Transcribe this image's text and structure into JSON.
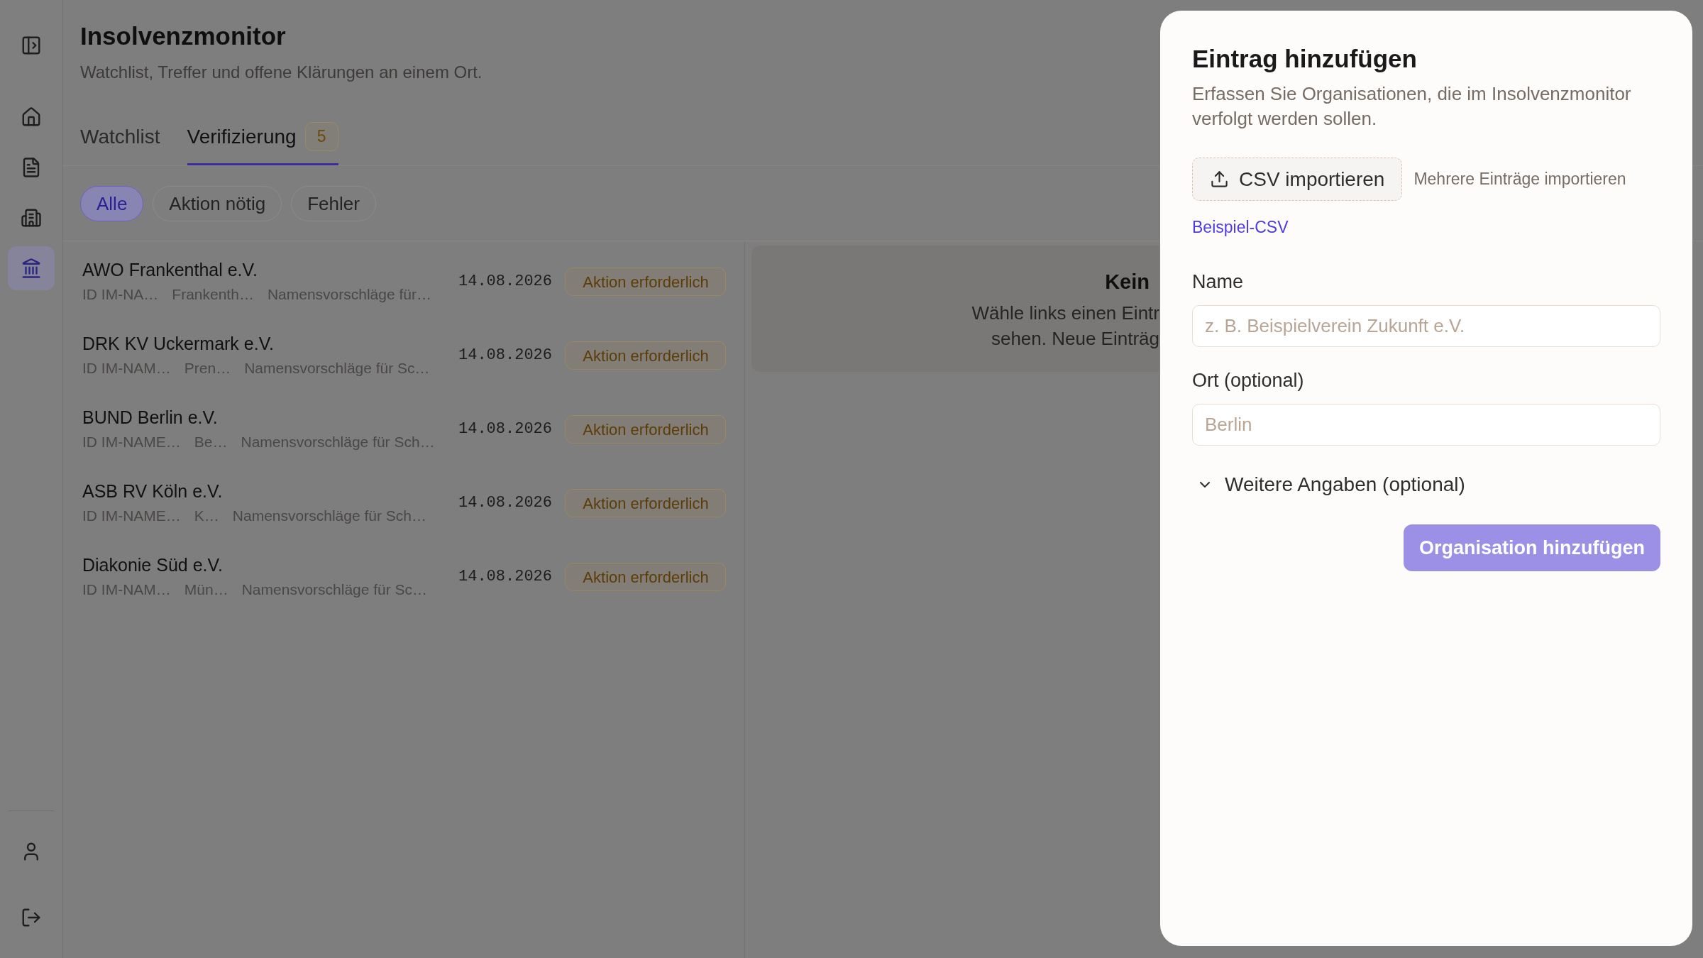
{
  "sidebar": {
    "nav": [
      {
        "selected": false
      },
      {
        "selected": false
      },
      {
        "selected": false
      },
      {
        "selected": true
      }
    ]
  },
  "header": {
    "title": "Insolvenzmonitor",
    "subtitle": "Watchlist, Treffer und offene Klärungen an einem Ort."
  },
  "tabs": [
    {
      "label": "Watchlist",
      "selected": false
    },
    {
      "label": "Verifizierung",
      "selected": true,
      "count": "5"
    }
  ],
  "filters": [
    {
      "label": "Alle",
      "selected": true
    },
    {
      "label": "Aktion nötig",
      "selected": false
    },
    {
      "label": "Fehler",
      "selected": false
    }
  ],
  "list": {
    "rows": [
      {
        "name": "AWO Frankenthal e.V.",
        "id": "ID IM-NA…",
        "place": "Frankenth…",
        "note": "Namensvorschläge für…",
        "date": "14.08.2026",
        "status": "Aktion erforderlich"
      },
      {
        "name": "DRK KV Uckermark e.V.",
        "id": "ID IM-NAM…",
        "place": "Pren…",
        "note": "Namensvorschläge für Sc…",
        "date": "14.08.2026",
        "status": "Aktion erforderlich"
      },
      {
        "name": "BUND Berlin e.V.",
        "id": "ID IM-NAME…",
        "place": "Be…",
        "note": "Namensvorschläge für Sch…",
        "date": "14.08.2026",
        "status": "Aktion erforderlich"
      },
      {
        "name": "ASB RV Köln e.V.",
        "id": "ID IM-NAME…",
        "place": "K…",
        "note": "Namensvorschläge für Sch…",
        "date": "14.08.2026",
        "status": "Aktion erforderlich"
      },
      {
        "name": "Diakonie Süd e.V.",
        "id": "ID IM-NAM…",
        "place": "Mün…",
        "note": "Namensvorschläge für Sc…",
        "date": "14.08.2026",
        "status": "Aktion erforderlich"
      }
    ]
  },
  "detail": {
    "title": "Kein",
    "text_lines": [
      "Wähle links einen Eintr",
      "sehen. Neue Einträg"
    ]
  },
  "dialog": {
    "title": "Eintrag hinzufügen",
    "description": "Erfassen Sie Organisationen, die im Insolvenzmonitor verfolgt werden sollen.",
    "import_button": "CSV importieren",
    "import_hint": "Mehrere Einträge importieren",
    "sample_link": "Beispiel-CSV",
    "fields": [
      {
        "label": "Name",
        "placeholder": "z. B. Beispielverein Zukunft e.V."
      },
      {
        "label": "Ort (optional)",
        "placeholder": "Berlin"
      }
    ],
    "more": {
      "label": "Weitere Angaben (optional)",
      "expanded": false
    },
    "submit": {
      "label": "Organisation hinzufügen",
      "disabled": true
    }
  }
}
